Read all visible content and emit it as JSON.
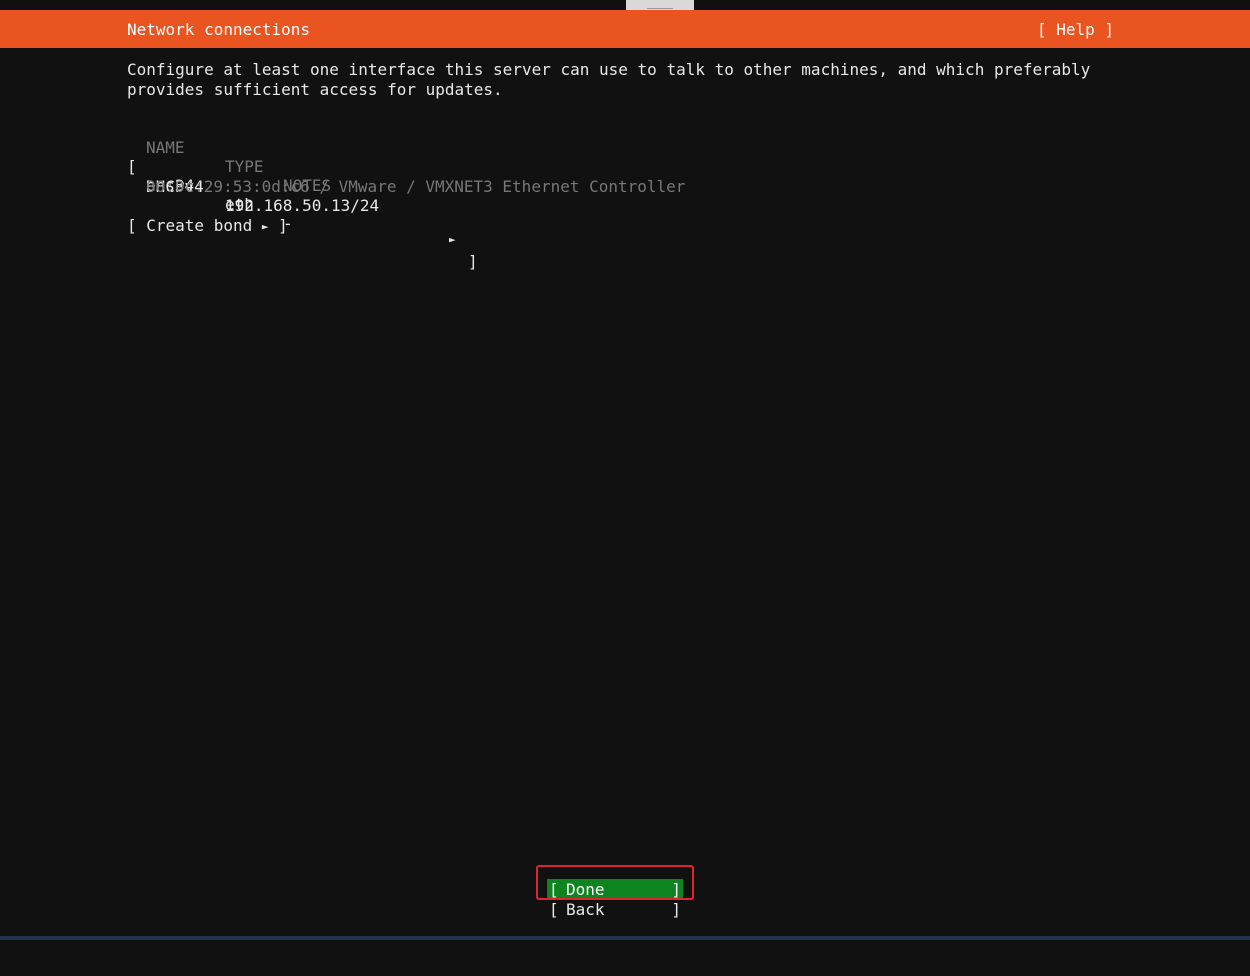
{
  "header": {
    "title": "Network connections",
    "help": "[ Help ]",
    "accent_color": "#e95420"
  },
  "intro": {
    "line1": "Configure at least one interface this server can use to talk to other machines, and which preferably",
    "line2": "provides sufficient access for updates."
  },
  "table": {
    "columns": [
      "NAME",
      "TYPE",
      "NOTES"
    ],
    "interface": {
      "open_bracket": "[",
      "name": "ens34",
      "type": "eth",
      "notes": "-",
      "arrow": "►",
      "close_bracket": "]",
      "addr_method": "DHCPv4",
      "address": "192.168.50.13/24",
      "hardware": "00:0c:29:53:0d:c6 / VMware / VMXNET3 Ethernet Controller"
    }
  },
  "create_bond": {
    "label": "[ Create bond",
    "arrow": "►",
    "close": "]"
  },
  "buttons": {
    "done": {
      "lb": "[",
      "label": "Done",
      "rb": "]",
      "color": "#0e8420"
    },
    "back": {
      "lb": "[",
      "label": "Back",
      "rb": "]"
    }
  },
  "highlight_color": "#e0242a"
}
